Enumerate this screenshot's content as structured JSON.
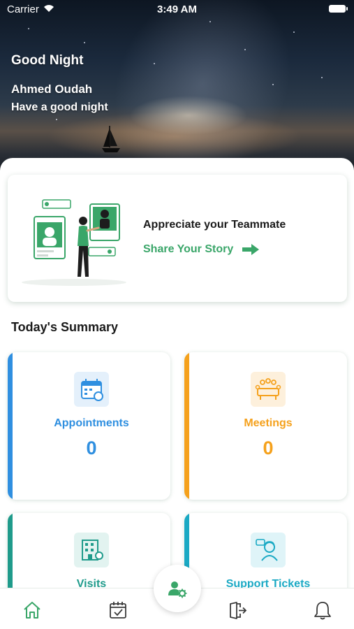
{
  "status_bar": {
    "carrier": "Carrier",
    "time": "3:49 AM"
  },
  "header": {
    "greeting": "Good Night",
    "user_name": "Ahmed Oudah",
    "message": "Have a good night"
  },
  "appreciate_card": {
    "title": "Appreciate your Teammate",
    "link_label": "Share Your Story"
  },
  "summary": {
    "title": "Today's Summary",
    "cards": [
      {
        "label": "Appointments",
        "count": "0",
        "color": "#2f8fe0",
        "icon": "calendar-icon"
      },
      {
        "label": "Meetings",
        "count": "0",
        "color": "#f5a11c",
        "icon": "meeting-icon"
      },
      {
        "label": "Visits",
        "color": "#1f9b8b",
        "icon": "building-icon"
      },
      {
        "label": "Support Tickets",
        "color": "#1aa9c4",
        "icon": "support-agent-icon"
      }
    ]
  },
  "bottom_nav": {
    "items": [
      "home-icon",
      "tasks-icon",
      "user-settings-icon",
      "logout-icon",
      "bell-icon"
    ],
    "active": "home-icon"
  },
  "colors": {
    "brand_green": "#3aa669",
    "appointments": "#2f8fe0",
    "meetings": "#f5a11c"
  }
}
